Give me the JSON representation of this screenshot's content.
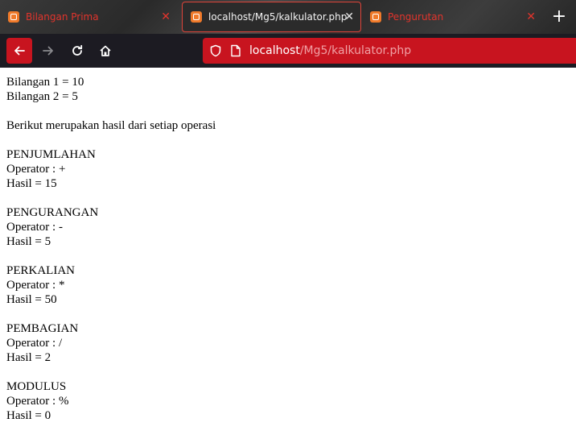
{
  "browser": {
    "tabs": [
      {
        "title": "Bilangan Prima",
        "active": false,
        "icon": "xampp-icon"
      },
      {
        "title": "localhost/Mg5/kalkulator.php",
        "active": true,
        "icon": "xampp-icon"
      },
      {
        "title": "Pengurutan",
        "active": false,
        "icon": "xampp-icon"
      }
    ],
    "url_host": "localhost",
    "url_path": "/Mg5/kalkulator.php",
    "accent_color": "#c8141f"
  },
  "page": {
    "input1": "Bilangan 1 = 10",
    "input2": "Bilangan 2 = 5",
    "intro": "Berikut merupakan hasil dari setiap operasi",
    "operations": [
      {
        "name": "PENJUMLAHAN",
        "operator": "Operator : +",
        "result": "Hasil = 15"
      },
      {
        "name": "PENGURANGAN",
        "operator": "Operator : -",
        "result": "Hasil = 5"
      },
      {
        "name": "PERKALIAN",
        "operator": "Operator : *",
        "result": "Hasil = 50"
      },
      {
        "name": "PEMBAGIAN",
        "operator": "Operator : /",
        "result": "Hasil = 2"
      },
      {
        "name": "MODULUS",
        "operator": "Operator : %",
        "result": "Hasil = 0"
      }
    ]
  }
}
